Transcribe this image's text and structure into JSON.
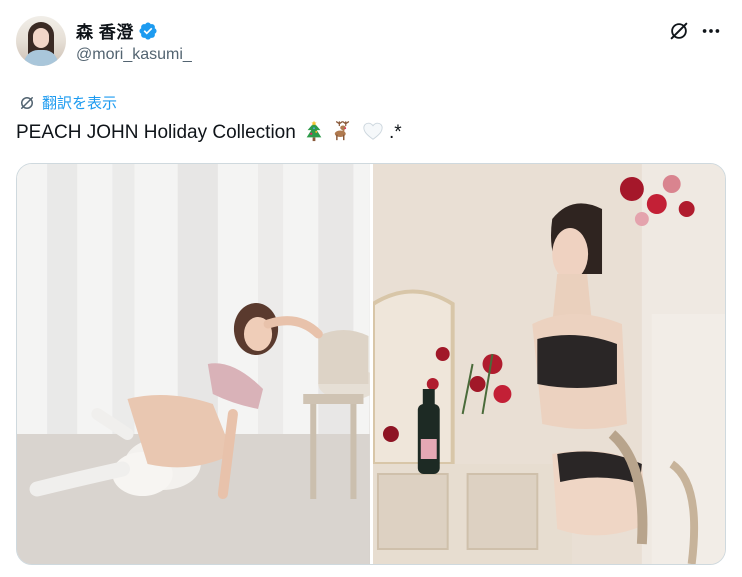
{
  "user": {
    "display_name": "森 香澄",
    "handle": "@mori_kasumi_"
  },
  "icons": {
    "verified": "verified-badge-icon",
    "grok": "grok-icon",
    "more": "more-icon",
    "translate": "translate-icon"
  },
  "translate_label": "翻訳を表示",
  "tweet": {
    "text": "PEACH JOHN Holiday Collection",
    "trailing": ".*",
    "emojis": [
      "christmas-tree",
      "deer",
      "white-heart"
    ]
  },
  "colors": {
    "accent": "#1d9bf0",
    "text": "#0f1419",
    "secondary": "#536471",
    "border": "#cfd9de"
  }
}
